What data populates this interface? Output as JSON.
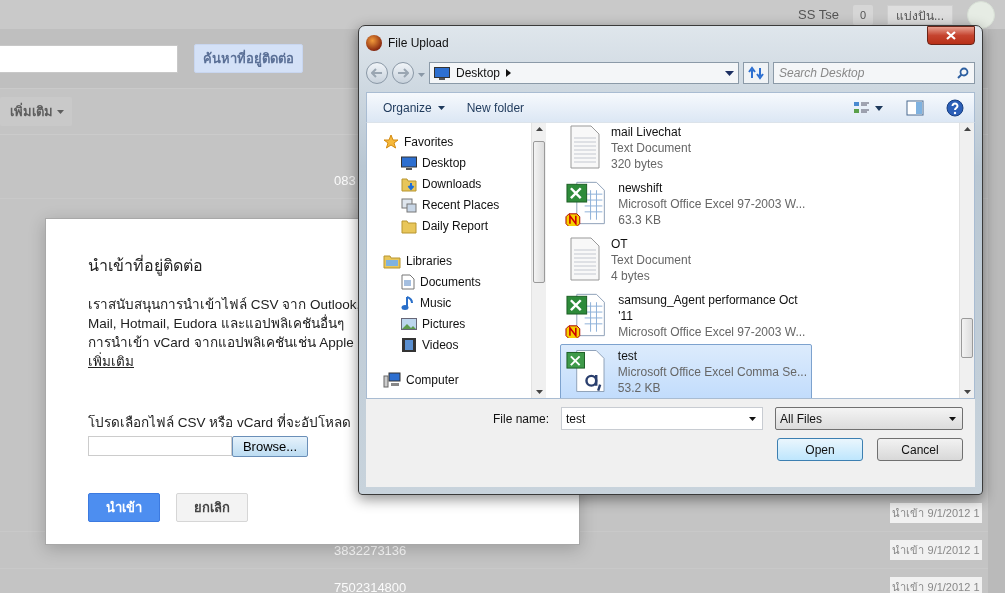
{
  "header": {
    "user_name": "SS Tse",
    "notification_count": "0",
    "share_button": "แบ่งปัน..."
  },
  "search": {
    "button": "ค้นหาที่อยู่ติดต่อ"
  },
  "toolbar": {
    "more_button": "เพิ่มเติม"
  },
  "contacts_top": [
    {
      "phone": "083"
    }
  ],
  "contacts_bottom": [
    {
      "imported": "นำเข้า 9/1/2012 1"
    },
    {
      "phone": "3832273136",
      "imported": "นำเข้า 9/1/2012 1"
    },
    {
      "phone": "7502314800",
      "imported": "นำเข้า 9/1/2012 1"
    }
  ],
  "import_dialog": {
    "title": "นำเข้าที่อยู่ติดต่อ",
    "description_lines": [
      "เราสนับสนุนการนำเข้าไฟล์ CSV จาก Outlook,",
      "Mail, Hotmail, Eudora และแอปพลิเคชันอื่นๆ",
      "การนำเข้า vCard จากแอปพลิเคชันเช่น Apple"
    ],
    "learn_more_link": "เพิ่มเติม",
    "file_prompt": "โปรดเลือกไฟล์ CSV หรือ vCard ที่จะอัปโหลด",
    "browse_button": "Browse...",
    "import_button": "นำเข้า",
    "cancel_button": "ยกเลิก"
  },
  "file_dialog": {
    "title": "File Upload",
    "address": "Desktop",
    "search_placeholder": "Search Desktop",
    "organize_button": "Organize",
    "new_folder_button": "New folder",
    "nav_groups": [
      {
        "label": "Favorites",
        "kind": "favorites",
        "children": [
          {
            "label": "Desktop",
            "kind": "desktop"
          },
          {
            "label": "Downloads",
            "kind": "downloads"
          },
          {
            "label": "Recent Places",
            "kind": "recent"
          },
          {
            "label": "Daily Report",
            "kind": "folder"
          }
        ]
      },
      {
        "label": "Libraries",
        "kind": "libraries",
        "children": [
          {
            "label": "Documents",
            "kind": "documents"
          },
          {
            "label": "Music",
            "kind": "music"
          },
          {
            "label": "Pictures",
            "kind": "pictures"
          },
          {
            "label": "Videos",
            "kind": "videos"
          }
        ]
      },
      {
        "label": "Computer",
        "kind": "computer"
      }
    ],
    "files": [
      {
        "name": "mail Livechat",
        "type": "Text Document",
        "size": "320 bytes",
        "kind": "text",
        "selected": false
      },
      {
        "name": "newshift",
        "type": "Microsoft Office Excel 97-2003 W...",
        "size": "63.3 KB",
        "kind": "excel",
        "selected": false
      },
      {
        "name": "OT",
        "type": "Text Document",
        "size": "4 bytes",
        "kind": "text",
        "selected": false
      },
      {
        "name": "samsung_Agent performance Oct '11",
        "type": "Microsoft Office Excel 97-2003 W...",
        "kind": "excel",
        "selected": false
      },
      {
        "name": "test",
        "type": "Microsoft Office Excel Comma Se...",
        "size": "53.2 KB",
        "kind": "csv",
        "selected": true
      }
    ],
    "file_name_label": "File name:",
    "file_name": "test",
    "file_type": "All Files",
    "open_button": "Open",
    "cancel_button": "Cancel"
  }
}
